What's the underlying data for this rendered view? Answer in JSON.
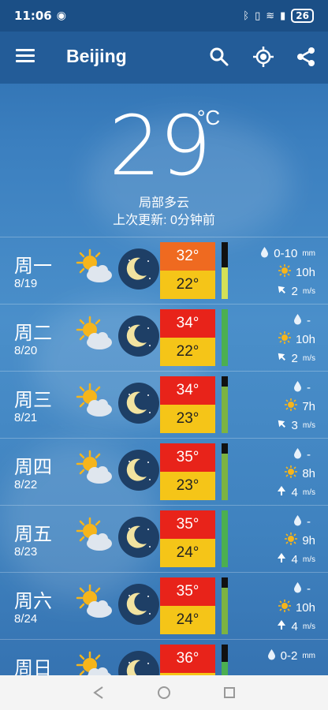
{
  "status": {
    "time": "11:06",
    "battery": "26"
  },
  "app": {
    "city": "Beijing"
  },
  "now": {
    "temp": "29",
    "unit": "°C",
    "condition": "局部多云",
    "updated": "上次更新: 0分钟前"
  },
  "colors": {
    "hot": "#e8231a",
    "warm": "#ef6a20",
    "low": "#f5c518",
    "green": "#4caf50",
    "lightgreen": "#8bc34a"
  },
  "days": [
    {
      "day": "周一",
      "date": "8/19",
      "hi": "32°",
      "lo": "22°",
      "precip": "0-10",
      "precip_unit": "mm",
      "sun": "10h",
      "wind": "2",
      "wind_unit": "m/s",
      "hi_color": "#ef6a20",
      "bar_color": "#d4e157",
      "bar_level": 0.55,
      "wind_dir": "nw"
    },
    {
      "day": "周二",
      "date": "8/20",
      "hi": "34°",
      "lo": "22°",
      "precip": "-",
      "precip_unit": "",
      "sun": "10h",
      "wind": "2",
      "wind_unit": "m/s",
      "hi_color": "#e8231a",
      "bar_color": "#4caf50",
      "bar_level": 1.0,
      "wind_dir": "nw"
    },
    {
      "day": "周三",
      "date": "8/21",
      "hi": "34°",
      "lo": "23°",
      "precip": "-",
      "precip_unit": "",
      "sun": "7h",
      "wind": "3",
      "wind_unit": "m/s",
      "hi_color": "#e8231a",
      "bar_color": "#7cb342",
      "bar_level": 0.82,
      "wind_dir": "nw"
    },
    {
      "day": "周四",
      "date": "8/22",
      "hi": "35°",
      "lo": "23°",
      "precip": "-",
      "precip_unit": "",
      "sun": "8h",
      "wind": "4",
      "wind_unit": "m/s",
      "hi_color": "#e8231a",
      "bar_color": "#7cb342",
      "bar_level": 0.82,
      "wind_dir": "n"
    },
    {
      "day": "周五",
      "date": "8/23",
      "hi": "35°",
      "lo": "24°",
      "precip": "-",
      "precip_unit": "",
      "sun": "9h",
      "wind": "4",
      "wind_unit": "m/s",
      "hi_color": "#e8231a",
      "bar_color": "#4caf50",
      "bar_level": 1.0,
      "wind_dir": "n"
    },
    {
      "day": "周六",
      "date": "8/24",
      "hi": "35°",
      "lo": "24°",
      "precip": "-",
      "precip_unit": "",
      "sun": "10h",
      "wind": "4",
      "wind_unit": "m/s",
      "hi_color": "#e8231a",
      "bar_color": "#7cb342",
      "bar_level": 0.82,
      "wind_dir": "n"
    },
    {
      "day": "周日",
      "date": "",
      "hi": "36°",
      "lo": "",
      "precip": "0-2",
      "precip_unit": "mm",
      "sun": "",
      "wind": "",
      "wind_unit": "",
      "hi_color": "#e8231a",
      "bar_color": "#4caf50",
      "bar_level": 0.7,
      "wind_dir": "n"
    }
  ]
}
